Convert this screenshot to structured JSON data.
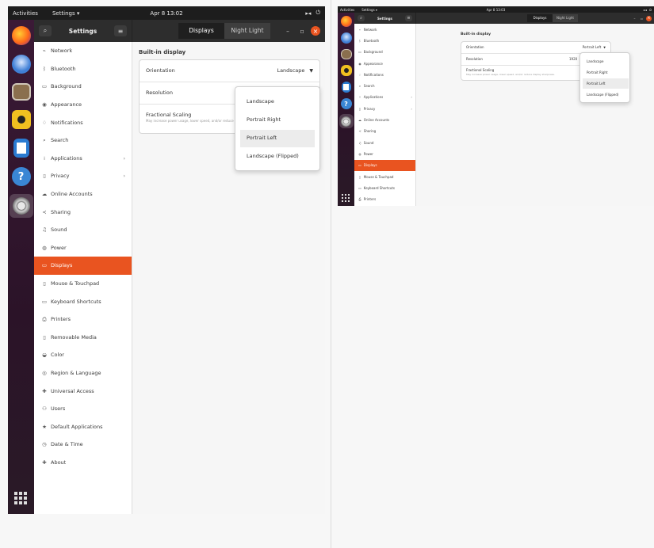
{
  "left": {
    "topbar": {
      "activities": "Activities",
      "app_menu": "Settings ▾",
      "clock": "Apr 8  13:02",
      "tray": [
        "▸◂",
        "⏻"
      ]
    },
    "dock": {
      "icons": [
        "firefox-icon",
        "thunderbird-icon",
        "files-icon",
        "rhythmbox-icon",
        "libreoffice-writer-icon",
        "help-icon",
        "settings-icon"
      ],
      "apps_grid": "apps-grid-icon"
    },
    "headerbar": {
      "title": "Settings",
      "tabs": [
        "Displays",
        "Night Light"
      ],
      "minimize": "–",
      "maximize": "▫",
      "close": "×"
    },
    "sidebar": {
      "items": [
        {
          "icon": "⌁",
          "label": "Network"
        },
        {
          "icon": "ᛒ",
          "label": "Bluetooth"
        },
        {
          "icon": "▭",
          "label": "Background"
        },
        {
          "icon": "◉",
          "label": "Appearance"
        },
        {
          "icon": "♢",
          "label": "Notifications"
        },
        {
          "icon": "⌕",
          "label": "Search"
        },
        {
          "icon": "⁞",
          "label": "Applications",
          "arrow": true
        },
        {
          "icon": "▯",
          "label": "Privacy",
          "arrow": true
        },
        {
          "icon": "☁",
          "label": "Online Accounts"
        },
        {
          "icon": "≺",
          "label": "Sharing"
        },
        {
          "icon": "♫",
          "label": "Sound"
        },
        {
          "icon": "◍",
          "label": "Power"
        },
        {
          "icon": "▭",
          "label": "Displays",
          "selected": true
        },
        {
          "icon": "▯",
          "label": "Mouse & Touchpad"
        },
        {
          "icon": "▭",
          "label": "Keyboard Shortcuts"
        },
        {
          "icon": "⎙",
          "label": "Printers"
        },
        {
          "icon": "▯",
          "label": "Removable Media"
        },
        {
          "icon": "◒",
          "label": "Color"
        },
        {
          "icon": "◎",
          "label": "Region & Language"
        },
        {
          "icon": "✚",
          "label": "Universal Access"
        },
        {
          "icon": "⚇",
          "label": "Users"
        },
        {
          "icon": "★",
          "label": "Default Applications"
        },
        {
          "icon": "◷",
          "label": "Date & Time"
        },
        {
          "icon": "✚",
          "label": "About"
        }
      ]
    },
    "content": {
      "section_title": "Built-in display",
      "orientation_label": "Orientation",
      "orientation_value": "Landscape",
      "resolution_label": "Resolution",
      "fractional_label": "Fractional Scaling",
      "fractional_sub": "May increase power usage, lower speed, and/or reduce display sharpness.",
      "popover_items": [
        "Landscape",
        "Portrait Right",
        "Portrait Left",
        "Landscape (Flipped)"
      ],
      "popover_highlight_index": 2
    }
  },
  "right": {
    "topbar": {
      "activities": "Activities",
      "app_menu": "Settings ▾",
      "clock": "Apr 8  13:03",
      "tray": [
        "▸◂",
        "⏻"
      ]
    },
    "headerbar": {
      "title": "Settings",
      "tabs": [
        "Displays",
        "Night Light"
      ]
    },
    "sidebar": {
      "items": [
        {
          "icon": "⌁",
          "label": "Network"
        },
        {
          "icon": "ᛒ",
          "label": "Bluetooth"
        },
        {
          "icon": "▭",
          "label": "Background"
        },
        {
          "icon": "◉",
          "label": "Appearance"
        },
        {
          "icon": "♢",
          "label": "Notifications"
        },
        {
          "icon": "⌕",
          "label": "Search"
        },
        {
          "icon": "⁞",
          "label": "Applications",
          "arrow": true
        },
        {
          "icon": "▯",
          "label": "Privacy",
          "arrow": true
        },
        {
          "icon": "☁",
          "label": "Online Accounts"
        },
        {
          "icon": "≺",
          "label": "Sharing"
        },
        {
          "icon": "♫",
          "label": "Sound"
        },
        {
          "icon": "◍",
          "label": "Power"
        },
        {
          "icon": "▭",
          "label": "Displays",
          "selected": true
        },
        {
          "icon": "▯",
          "label": "Mouse & Touchpad"
        },
        {
          "icon": "▭",
          "label": "Keyboard Shortcuts"
        },
        {
          "icon": "⎙",
          "label": "Printers"
        }
      ]
    },
    "content": {
      "section_title": "Built-in display",
      "orientation_label": "Orientation",
      "orientation_value": "Portrait Left",
      "resolution_label": "Resolution",
      "resolution_value": "1920",
      "fractional_label": "Fractional Scaling",
      "fractional_sub": "May increase power usage, lower speed, and/or reduce display sharpness.",
      "popover_items": [
        "Landscape",
        "Portrait Right",
        "Portrait Left",
        "Landscape (Flipped)"
      ],
      "popover_highlight_index": 2
    }
  },
  "colors": {
    "accent": "#e95420",
    "topbar": "#1d1d1d",
    "headerbar": "#2d2d2d",
    "dock": "#2b1328"
  }
}
